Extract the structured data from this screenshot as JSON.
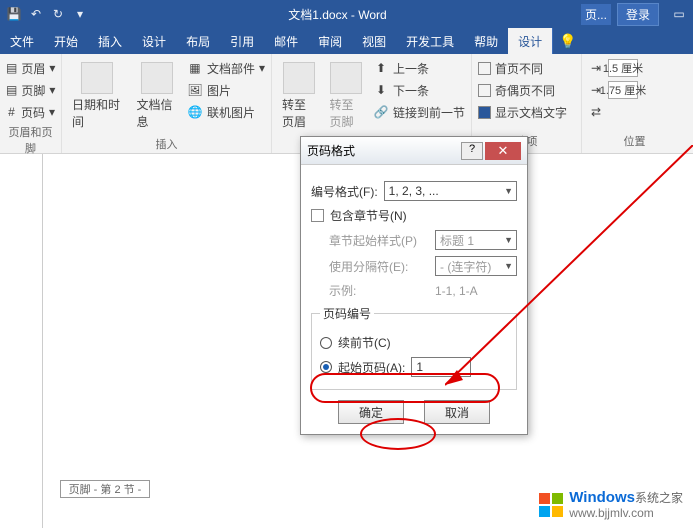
{
  "title": "文档1.docx - Word",
  "login": "登录",
  "page_btn": "页...",
  "tabs": [
    "文件",
    "开始",
    "插入",
    "设计",
    "布局",
    "引用",
    "邮件",
    "审阅",
    "视图",
    "开发工具",
    "帮助",
    "设计"
  ],
  "ribbon": {
    "g1": {
      "items": [
        "页眉",
        "页脚",
        "页码"
      ],
      "label": "页眉和页脚"
    },
    "g2": {
      "big": [
        "日期和时间",
        "文档信息"
      ],
      "side": [
        "文档部件",
        "图片",
        "联机图片"
      ],
      "label": "插入"
    },
    "g3": {
      "big": [
        "转至页眉",
        "转至页脚"
      ],
      "side": [
        "上一条",
        "下一条",
        "链接到前一节"
      ]
    },
    "g4": {
      "items": [
        "首页不同",
        "奇偶页不同",
        "显示文档文字"
      ],
      "label": "选项"
    },
    "g5": {
      "v1": "1.5 厘米",
      "v2": "1.75 厘米",
      "label": "位置"
    }
  },
  "footer_label": "页脚 - 第 2 节 -",
  "dlg": {
    "title": "页码格式",
    "fmt_label": "编号格式(F):",
    "fmt_value": "1, 2, 3, ...",
    "chapter": "包含章节号(N)",
    "chapter_style_l": "章节起始样式(P)",
    "chapter_style_v": "标题 1",
    "sep_l": "使用分隔符(E):",
    "sep_v": "- (连字符)",
    "example_l": "示例:",
    "example_v": "1-1, 1-A",
    "pn_legend": "页码编号",
    "cont": "续前节(C)",
    "start": "起始页码(A):",
    "start_v": "1",
    "ok": "确定",
    "cancel": "取消"
  },
  "wm": {
    "brand": "Windows",
    "suffix": "系统之家",
    "url": "www.bjjmlv.com"
  }
}
